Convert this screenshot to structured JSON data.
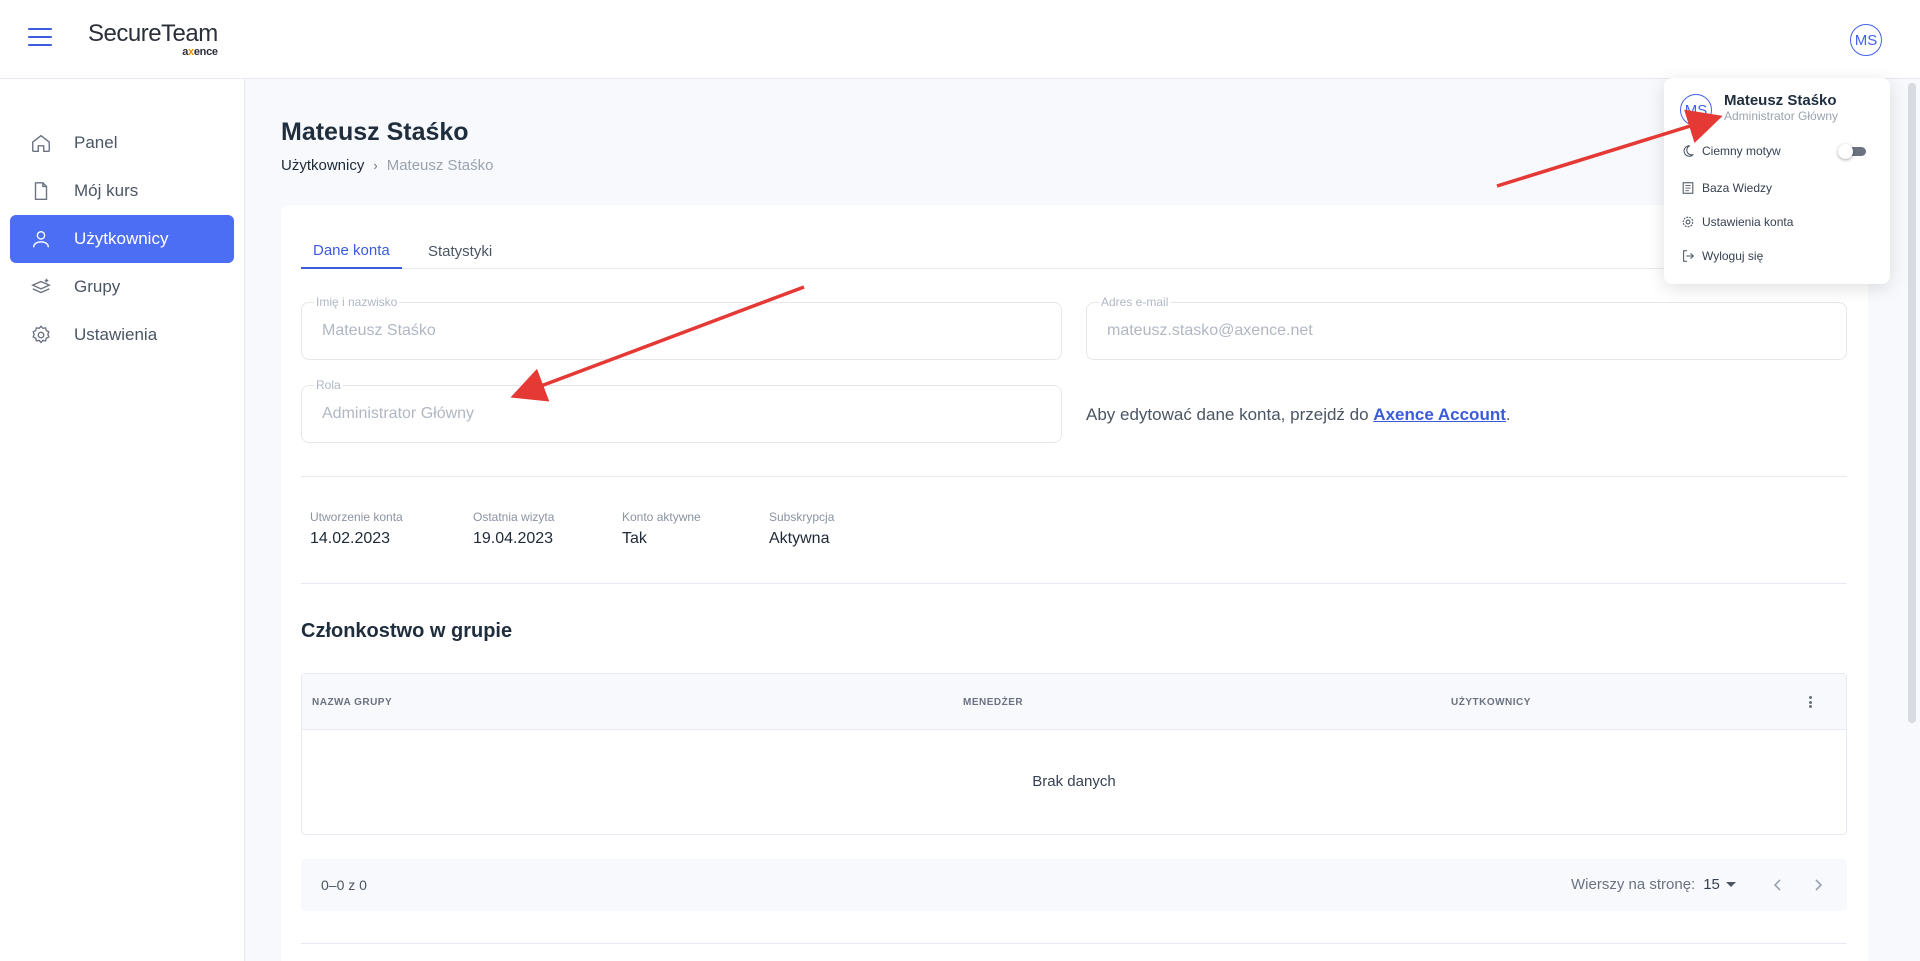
{
  "header": {
    "logo_main": "SecureTeam",
    "logo_sub_prefix": "a",
    "logo_sub_accent": "x",
    "logo_sub_suffix": "ence",
    "avatar_initials": "MS"
  },
  "sidebar": {
    "items": [
      {
        "label": "Panel",
        "icon": "home-icon"
      },
      {
        "label": "Mój kurs",
        "icon": "file-icon"
      },
      {
        "label": "Użytkownicy",
        "icon": "user-icon",
        "active": true
      },
      {
        "label": "Grupy",
        "icon": "layers-icon"
      },
      {
        "label": "Ustawienia",
        "icon": "gear-icon"
      }
    ]
  },
  "page": {
    "title": "Mateusz Staśko",
    "breadcrumb": {
      "parent": "Użytkownicy",
      "separator": "›",
      "current": "Mateusz Staśko"
    }
  },
  "tabs": [
    {
      "label": "Dane konta",
      "active": true
    },
    {
      "label": "Statystyki",
      "active": false
    }
  ],
  "form": {
    "name": {
      "label": "Imię i nazwisko",
      "value": "Mateusz Staśko"
    },
    "email": {
      "label": "Adres e-mail",
      "value": "mateusz.stasko@axence.net"
    },
    "role": {
      "label": "Rola",
      "value": "Administrator Główny"
    },
    "edit_note_prefix": "Aby edytować dane konta, przejdź do ",
    "edit_note_link": "Axence Account",
    "edit_note_suffix": "."
  },
  "stats": [
    {
      "label": "Utworzenie konta",
      "value": "14.02.2023"
    },
    {
      "label": "Ostatnia wizyta",
      "value": "19.04.2023"
    },
    {
      "label": "Konto aktywne",
      "value": "Tak"
    },
    {
      "label": "Subskrypcja",
      "value": "Aktywna"
    }
  ],
  "membership": {
    "title": "Członkostwo w grupie",
    "columns": [
      "NAZWA GRUPY",
      "MENEDŻER",
      "UŻYTKOWNICY"
    ],
    "empty_text": "Brak danych"
  },
  "pagination": {
    "range": "0–0 z 0",
    "rows_label": "Wierszy na stronę:",
    "rows_value": "15"
  },
  "user_menu": {
    "name": "Mateusz Staśko",
    "role": "Administrator Główny",
    "initials": "MS",
    "dark_mode_label": "Ciemny motyw",
    "dark_mode_on": false,
    "knowledge_base": "Baza Wiedzy",
    "account_settings": "Ustawienia konta",
    "logout": "Wyloguj się"
  },
  "colors": {
    "accent": "#4c6ef5",
    "annotation_arrow": "#e53935"
  }
}
